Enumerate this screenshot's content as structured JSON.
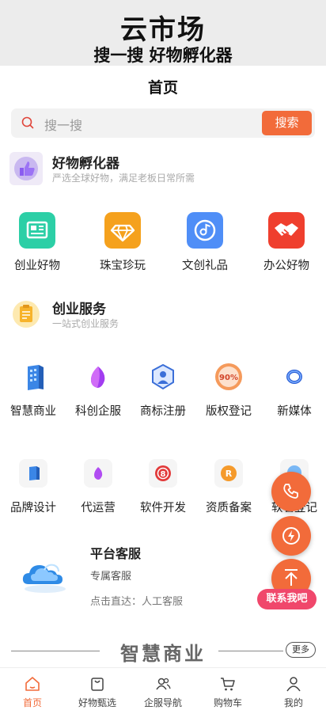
{
  "banner": {
    "title": "云市场",
    "subtitle": "搜一搜 好物孵化器"
  },
  "header": {
    "title": "首页"
  },
  "search": {
    "placeholder": "搜一搜",
    "button": "搜索"
  },
  "section1": {
    "title": "好物孵化器",
    "subtitle": "严选全球好物，满足老板日常所需",
    "items": [
      {
        "label": "创业好物",
        "icon": "newspaper-icon",
        "color": "#2ccfa6"
      },
      {
        "label": "珠宝珍玩",
        "icon": "diamond-icon",
        "color": "#f5a11d"
      },
      {
        "label": "文创礼品",
        "icon": "music-disc-icon",
        "color": "#4f8ef7"
      },
      {
        "label": "办公好物",
        "icon": "handshake-icon",
        "color": "#ef3f2e"
      }
    ]
  },
  "section2": {
    "title": "创业服务",
    "subtitle": "一站式创业服务",
    "row1": [
      {
        "label": "智慧商业",
        "icon": "building-icon"
      },
      {
        "label": "科创企服",
        "icon": "purple-crystal-icon"
      },
      {
        "label": "商标注册",
        "icon": "trademark-shield-icon"
      },
      {
        "label": "版权登记",
        "icon": "copyright-stamp-icon"
      },
      {
        "label": "新媒体",
        "icon": "ring-icon"
      }
    ],
    "row2": [
      {
        "label": "品牌设计",
        "icon": "building-icon"
      },
      {
        "label": "代运营",
        "icon": "purple-crystal-icon"
      },
      {
        "label": "软件开发",
        "icon": "software-badge-icon"
      },
      {
        "label": "资质备案",
        "icon": "r-coin-icon"
      },
      {
        "label": "软著登记",
        "icon": "software-copyright-icon"
      }
    ]
  },
  "service": {
    "title": "平台客服",
    "line1": "专属客服",
    "line2": "点击直达：人工客服"
  },
  "floating": {
    "contact": "联系我吧"
  },
  "divider": {
    "title": "智慧商业",
    "more": "更多"
  },
  "tabs": [
    {
      "label": "首页",
      "icon": "home-icon",
      "active": true
    },
    {
      "label": "好物甄选",
      "icon": "bag-icon",
      "active": false
    },
    {
      "label": "企服导航",
      "icon": "users-icon",
      "active": false
    },
    {
      "label": "购物车",
      "icon": "cart-icon",
      "active": false
    },
    {
      "label": "我的",
      "icon": "user-icon",
      "active": false
    }
  ],
  "colors": {
    "accent": "#f26b3a",
    "pink": "#f0476b"
  }
}
